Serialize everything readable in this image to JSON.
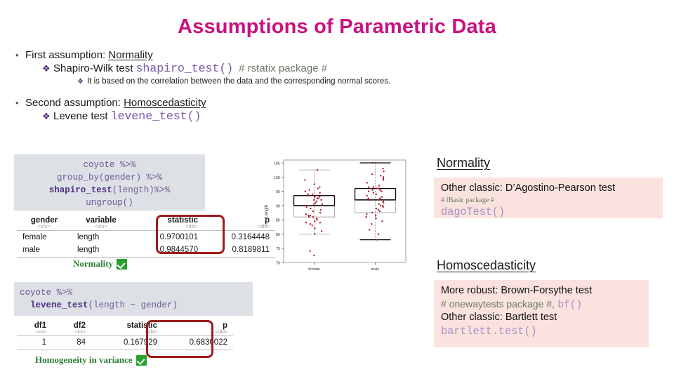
{
  "slide": {
    "title": "Assumptions of Parametric Data"
  },
  "bullets": {
    "bullet_marker": "•",
    "diamond_marker": "❖",
    "first": {
      "lead": "First assumption:",
      "term": "Normality"
    },
    "shapiro": {
      "lead": "Shapiro-Wilk test",
      "code": "shapiro_test()",
      "package": "# rstatix package #"
    },
    "sub_note": "It is based on the correlation between the data and the corresponding normal scores.",
    "second": {
      "lead": "Second assumption:",
      "term": "Homoscedasticity"
    },
    "levene": {
      "lead": "Levene test",
      "code": "levene_test()"
    }
  },
  "code_shapiro": {
    "line1": "coyote %>%",
    "line2": "group_by(gender) %>%",
    "line3_fn": "shapiro_test",
    "line3_rest": "(length)%>%",
    "line4": "ungroup()"
  },
  "code_levene": {
    "line1": "coyote %>%",
    "line2_fn": "levene_test",
    "line2_rest": "(length ~ gender)"
  },
  "table_shapiro": {
    "headers": [
      "gender",
      "variable",
      "statistic",
      "p"
    ],
    "types": [
      "<chr>",
      "<chr>",
      "<dbl>",
      "<dbl>"
    ],
    "rows": [
      [
        "female",
        "length",
        "0.9700101",
        "0.3164448"
      ],
      [
        "male",
        "length",
        "0.9844570",
        "0.8189811"
      ]
    ]
  },
  "table_levene": {
    "headers": [
      "df1",
      "df2",
      "statistic",
      "p"
    ],
    "types": [
      "<int>",
      "<int>",
      "<dbl>",
      "<dbl>"
    ],
    "rows": [
      [
        "1",
        "84",
        "0.167929",
        "0.6830022"
      ]
    ]
  },
  "conclusions": {
    "normality": "Normality",
    "homogeneity": "Homogeneity in variance"
  },
  "right": {
    "normality_heading": "Normality",
    "normality_line": "Other classic: D’Agostino-Pearson test",
    "normality_pkg": "# fBasic package #",
    "normality_code": "dagoTest()",
    "homosced_heading": "Homoscedasticity",
    "homosced_line1": "More robust: Brown-Forsythe test",
    "homosced_pkg": "# onewaytests package #,",
    "homosced_fn": "bf()",
    "homosced_line2": "Other classic: Bartlett test",
    "homosced_code": "bartlett.test()"
  },
  "colors": {
    "title": "#C9117F",
    "code_purple": "#6E5896",
    "code_bg": "#DDE1E6",
    "pink_bg": "#FAE3DE",
    "green": "#2E7D32",
    "red_oval": "#9E1B1B",
    "point_red": "#B01B2E"
  },
  "chart_data": {
    "type": "box",
    "title": "",
    "xlabel": "",
    "ylabel": "Length",
    "categories": [
      "female",
      "male"
    ],
    "ylim": [
      70,
      106
    ],
    "yticks": [
      105,
      100,
      95,
      90,
      85,
      80,
      75,
      70
    ],
    "grid": false,
    "series": [
      {
        "name": "female",
        "min_whisker": 80.0,
        "q1": 86.0,
        "median": 90.0,
        "q3": 93.5,
        "max_whisker": 102.5,
        "outliers": [
          74.0,
          72.5
        ],
        "points": [
          102.5,
          99.0,
          97.5,
          96.5,
          96.0,
          95.5,
          95.0,
          94.5,
          94.0,
          94.0,
          93.5,
          93.5,
          93.0,
          93.0,
          92.5,
          92.5,
          92.0,
          92.0,
          91.5,
          91.0,
          90.5,
          90.5,
          90.0,
          90.0,
          89.5,
          89.0,
          88.5,
          88.0,
          87.5,
          87.0,
          86.5,
          86.5,
          86.0,
          86.0,
          85.5,
          85.0,
          84.5,
          84.0,
          84.0,
          83.5,
          83.0,
          82.0,
          81.0,
          80.0,
          74.0,
          72.5
        ]
      },
      {
        "name": "male",
        "min_whisker": 78.0,
        "q1": 87.5,
        "median": 92.0,
        "q3": 96.0,
        "max_whisker": 105.0,
        "outliers": [],
        "points": [
          105.0,
          105.0,
          103.0,
          102.0,
          101.0,
          100.5,
          100.0,
          99.5,
          99.0,
          98.0,
          97.0,
          96.5,
          96.5,
          96.0,
          96.0,
          96.0,
          95.5,
          95.5,
          95.0,
          95.0,
          94.5,
          94.0,
          93.5,
          93.0,
          92.5,
          92.5,
          92.0,
          92.0,
          91.5,
          91.0,
          90.5,
          90.0,
          90.0,
          89.5,
          89.0,
          88.5,
          88.0,
          87.5,
          87.0,
          86.5,
          86.0,
          85.5,
          84.5,
          83.5,
          81.5,
          80.0,
          78.0
        ]
      }
    ]
  }
}
